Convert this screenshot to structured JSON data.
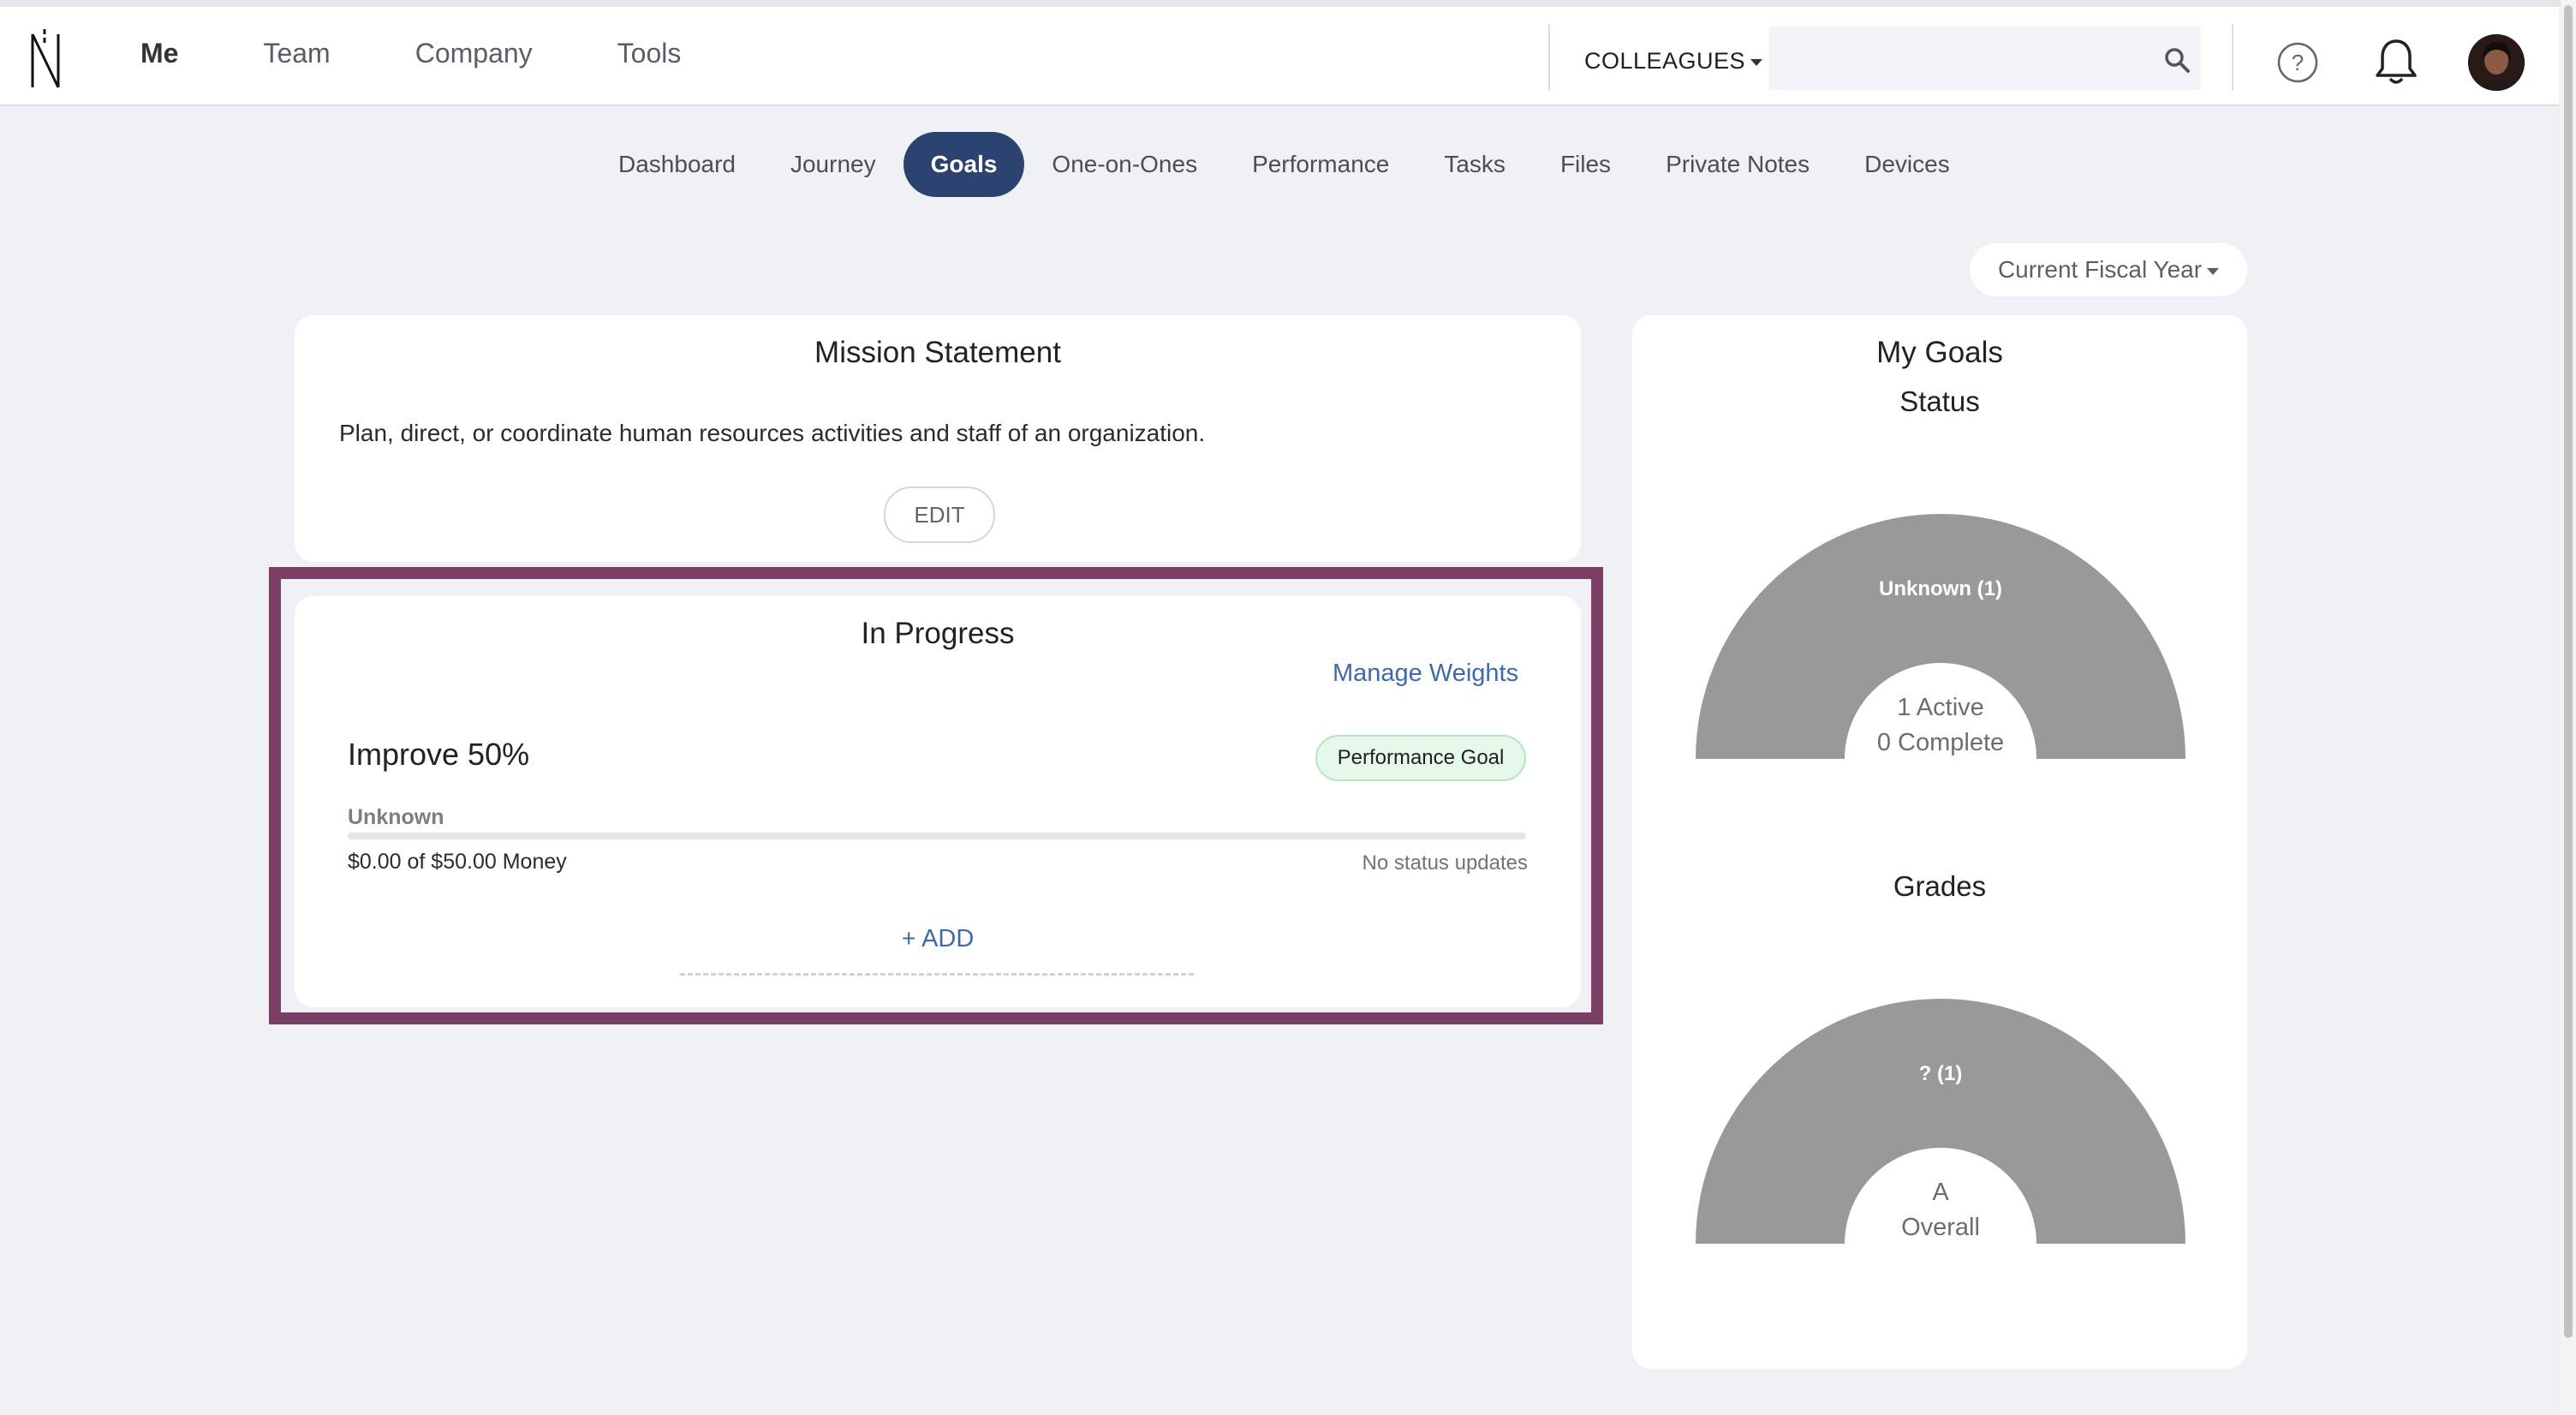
{
  "header": {
    "nav": [
      "Me",
      "Team",
      "Company",
      "Tools"
    ],
    "active_nav": "Me",
    "colleagues_label": "COLLEAGUES",
    "search_placeholder": ""
  },
  "subnav": {
    "tabs": [
      "Dashboard",
      "Journey",
      "Goals",
      "One-on-Ones",
      "Performance",
      "Tasks",
      "Files",
      "Private Notes",
      "Devices"
    ],
    "active": "Goals"
  },
  "fiscal_filter": "Current Fiscal Year",
  "mission": {
    "title": "Mission Statement",
    "text": "Plan, direct, or coordinate human resources activities and staff of an organization.",
    "edit_label": "EDIT"
  },
  "in_progress": {
    "title": "In Progress",
    "manage_label": "Manage Weights",
    "goal": {
      "title": "Improve 50%",
      "badge": "Performance Goal",
      "status": "Unknown",
      "progress": 0,
      "amount": "$0.00 of $50.00 Money",
      "updates": "No status updates"
    },
    "add_label": "+ ADD"
  },
  "my_goals": {
    "title": "My Goals",
    "status": {
      "title": "Status",
      "slice_label": "Unknown (1)",
      "center_line1": "1 Active",
      "center_line2": "0 Complete",
      "color": "#999999"
    },
    "grades": {
      "title": "Grades",
      "slice_label": "? (1)",
      "center_line1": "A",
      "center_line2": "Overall",
      "color": "#999999"
    }
  }
}
